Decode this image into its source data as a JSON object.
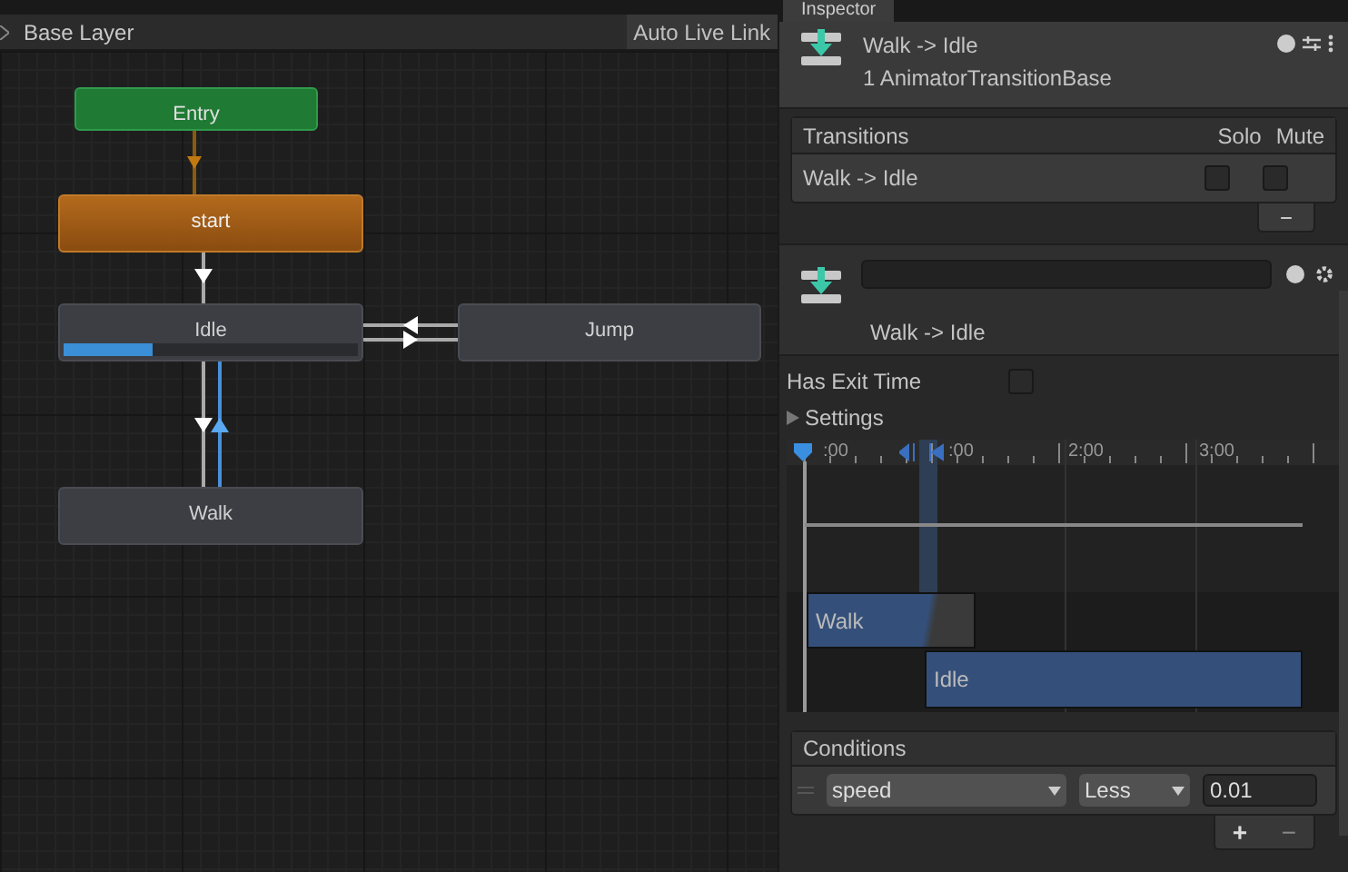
{
  "graph": {
    "breadcrumb": "Base Layer",
    "live_link_button": "Auto Live Link",
    "states": [
      {
        "label": "Entry",
        "kind": "entry"
      },
      {
        "label": "start",
        "kind": "default"
      },
      {
        "label": "Idle",
        "kind": "state",
        "level": 0.3
      },
      {
        "label": "Jump",
        "kind": "state"
      },
      {
        "label": "Walk",
        "kind": "state"
      }
    ]
  },
  "inspector": {
    "tab": "Inspector",
    "title": "Walk -> Idle",
    "subtitle": "1 AnimatorTransitionBase",
    "transitions": {
      "heading": "Transitions",
      "solo_label": "Solo",
      "mute_label": "Mute",
      "rows": [
        {
          "name": "Walk -> Idle",
          "solo": false,
          "mute": false
        }
      ],
      "remove_button": "−"
    },
    "transition": {
      "name": "Walk -> Idle",
      "has_exit_time_label": "Has Exit Time",
      "has_exit_time": false,
      "settings_label": "Settings",
      "settings_expanded": false,
      "ruler": [
        ":00",
        ":00",
        "2:00",
        "3:00"
      ],
      "clips": [
        "Walk",
        "Idle"
      ]
    },
    "conditions": {
      "heading": "Conditions",
      "rows": [
        {
          "parameter": "speed",
          "mode": "Less",
          "value": "0.01"
        }
      ],
      "add_button": "+",
      "remove_button": "−"
    }
  }
}
